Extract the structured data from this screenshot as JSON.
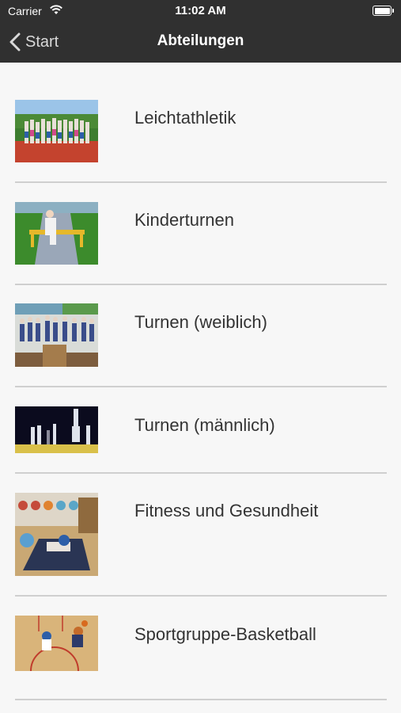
{
  "status_bar": {
    "carrier": "Carrier",
    "time": "11:02 AM",
    "battery_level": 1.0
  },
  "nav": {
    "back_label": "Start",
    "title": "Abteilungen"
  },
  "items": [
    {
      "label": "Leichtathletik"
    },
    {
      "label": "Kinderturnen"
    },
    {
      "label": "Turnen (weiblich)"
    },
    {
      "label": "Turnen (männlich)"
    },
    {
      "label": "Fitness und Gesundheit"
    },
    {
      "label": "Sportgruppe-Basketball"
    }
  ]
}
